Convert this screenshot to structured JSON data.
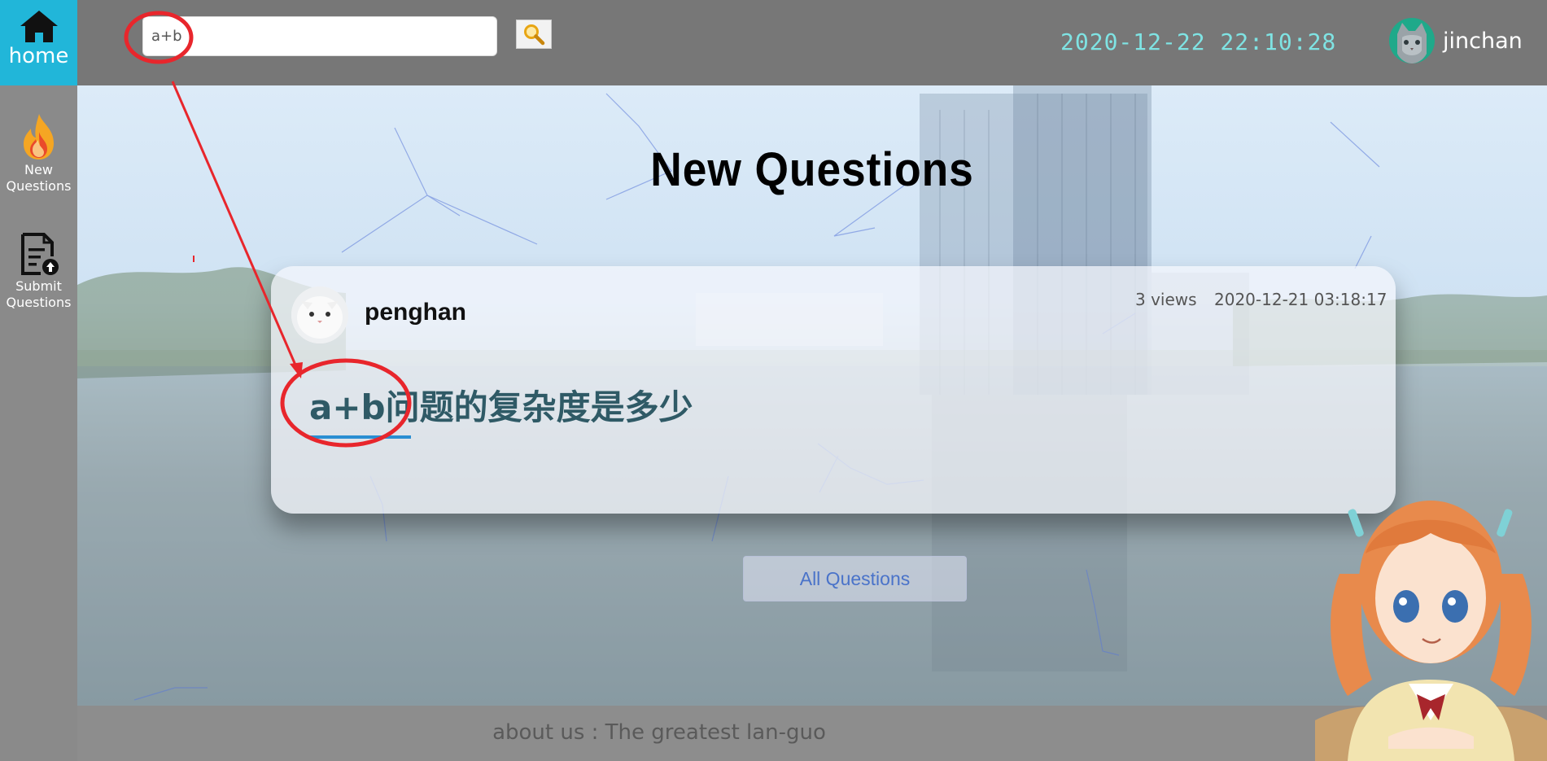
{
  "sidebar": {
    "home_label": "home",
    "items": [
      {
        "label_line1": "New",
        "label_line2": "Questions",
        "icon": "flame-icon"
      },
      {
        "label_line1": "Submit",
        "label_line2": "Questions",
        "icon": "document-upload-icon"
      }
    ]
  },
  "header": {
    "search_value": "a+b",
    "search_icon": "search-icon",
    "datetime": "2020-12-22 22:10:28",
    "username": "jinchan"
  },
  "main": {
    "title": "New Questions",
    "question": {
      "author": "penghan",
      "views": "3 views",
      "date": "2020-12-21 03:18:17",
      "title": "a+b问题的复杂度是多少"
    },
    "all_questions_label": "All Questions"
  },
  "footer": {
    "text": "about us : The greatest lan-guo"
  },
  "colors": {
    "accent": "#21b6d9",
    "clock": "#7fe3e3",
    "annotation": "#e8262c",
    "question_title": "#2f5a66"
  }
}
